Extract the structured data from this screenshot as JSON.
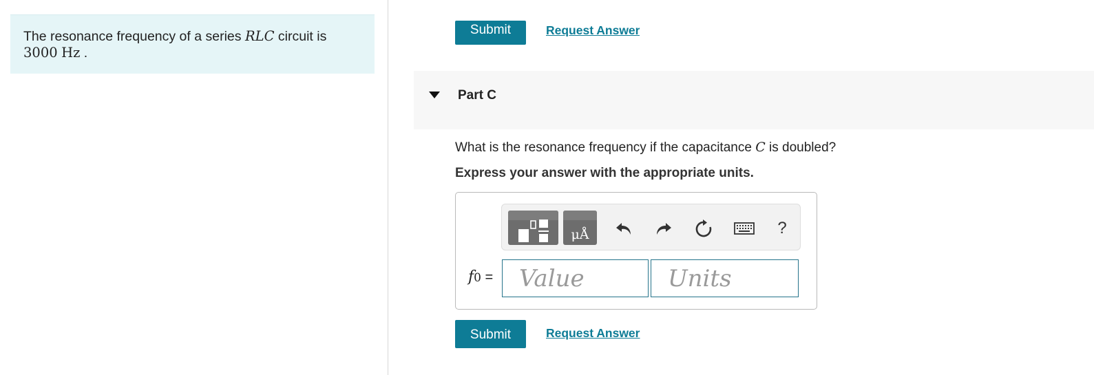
{
  "problem": {
    "text_prefix": "The resonance frequency of a series ",
    "circuit_symbol": "RLC",
    "text_suffix": " circuit is",
    "value": "3000",
    "unit": "Hz",
    "end": " ."
  },
  "previous_part": {
    "submit_label": "Submit",
    "request_label": "Request Answer"
  },
  "part": {
    "title": "Part C",
    "question_prefix": "What is the resonance frequency if the capacitance ",
    "question_symbol": "C",
    "question_suffix": " is doubled?",
    "instruction": "Express your answer with the appropriate units."
  },
  "answer": {
    "lhs_symbol": "f",
    "lhs_subscript": "0",
    "lhs_equals": " =",
    "value_placeholder": "Value",
    "units_placeholder": "Units",
    "value": "",
    "units": ""
  },
  "toolbar": {
    "units_glyph": "μÅ",
    "help_label": "?",
    "icons": [
      "templates-icon",
      "units-icon",
      "undo-icon",
      "redo-icon",
      "reset-icon",
      "keyboard-icon",
      "help-icon"
    ]
  },
  "actions": {
    "submit_label": "Submit",
    "request_label": "Request Answer"
  },
  "colors": {
    "accent": "#0e7c96",
    "problem_bg": "#e5f5f7",
    "part_header_bg": "#f7f7f7"
  }
}
